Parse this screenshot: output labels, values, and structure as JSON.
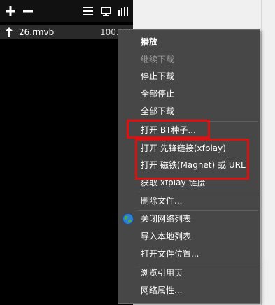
{
  "toolbar": {
    "buttons": [
      "plus-icon",
      "minus-icon",
      "list-icon",
      "screen-icon",
      "bars-icon"
    ]
  },
  "files": [
    {
      "name": "26.rmvb",
      "progress": "100.0%"
    }
  ],
  "context_menu": {
    "items": [
      {
        "label": "播放",
        "state": "bold"
      },
      {
        "label": "继续下载",
        "state": "disabled"
      },
      {
        "label": "停止下载",
        "state": "normal"
      },
      {
        "label": "全部停止",
        "state": "normal"
      },
      {
        "label": "全部下载",
        "state": "normal"
      },
      {
        "label": "打开 BT种子...",
        "state": "normal"
      },
      {
        "label": "打开 先锋链接(xfplay)",
        "state": "normal"
      },
      {
        "label": "打开 磁铁(Magnet) 或 URL",
        "state": "normal"
      },
      {
        "label": "获取 xfplay 链接",
        "state": "normal"
      },
      {
        "label": "删除文件...",
        "state": "normal"
      },
      {
        "label": "关闭网络列表",
        "state": "normal",
        "icon": "globe-icon"
      },
      {
        "label": "导入本地列表",
        "state": "normal"
      },
      {
        "label": "打开文件位置...",
        "state": "normal"
      },
      {
        "label": "浏览引用页",
        "state": "normal"
      },
      {
        "label": "网络属性...",
        "state": "normal"
      }
    ]
  },
  "colors": {
    "highlight": "#e01010",
    "menu_bg": "#474747",
    "panel_bg": "#000000"
  }
}
